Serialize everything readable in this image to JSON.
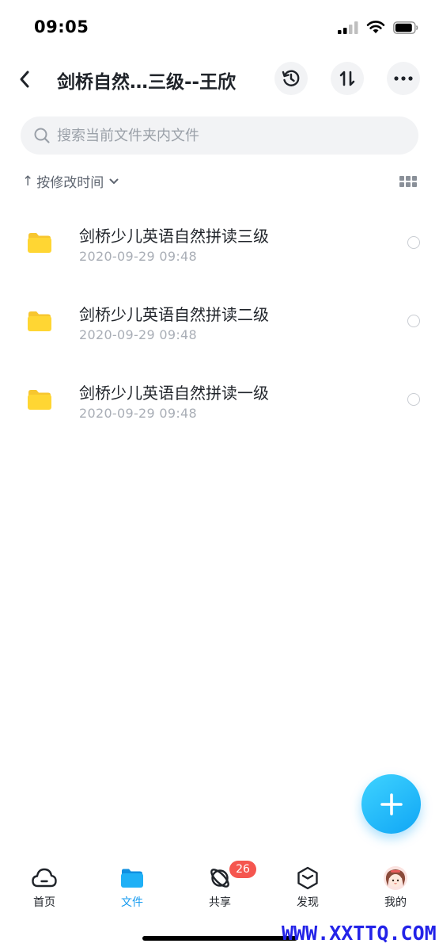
{
  "status_bar": {
    "time": "09:05"
  },
  "nav": {
    "title": "剑桥自然…三级--王欣",
    "icons": {
      "back": "chevron-left-icon",
      "history": "history-icon",
      "transfer": "transfer-icon",
      "more": "more-icon"
    }
  },
  "search": {
    "placeholder": "搜索当前文件夹内文件",
    "value": ""
  },
  "sort": {
    "label": "按修改时间",
    "arrow": "↑"
  },
  "files": [
    {
      "name": "剑桥少儿英语自然拼读三级",
      "date": "2020-09-29 09:48"
    },
    {
      "name": "剑桥少儿英语自然拼读二级",
      "date": "2020-09-29 09:48"
    },
    {
      "name": "剑桥少儿英语自然拼读一级",
      "date": "2020-09-29 09:48"
    }
  ],
  "tabs": [
    {
      "label": "首页",
      "icon": "cloud-icon"
    },
    {
      "label": "文件",
      "icon": "folder-icon"
    },
    {
      "label": "共享",
      "icon": "orbit-icon"
    },
    {
      "label": "发现",
      "icon": "box-icon"
    },
    {
      "label": "我的",
      "icon": "avatar-icon"
    }
  ],
  "share_badge": "26",
  "watermark": "WWW.XXTTQ.COM",
  "colors": {
    "accent": "#169bf0",
    "folder": "#ffd633",
    "badge": "#f5564f",
    "fab": "#10a6f5"
  }
}
